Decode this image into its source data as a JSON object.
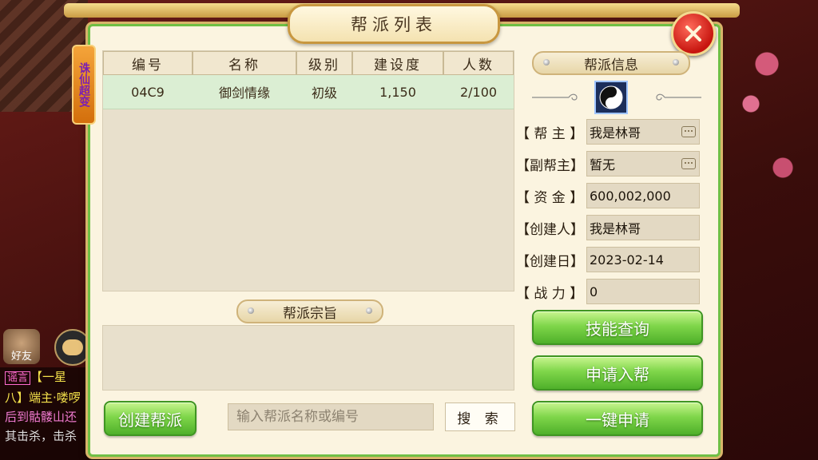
{
  "dialog": {
    "title": "帮派列表",
    "side_tab": "诛仙超变"
  },
  "table": {
    "headers": [
      "编号",
      "名称",
      "级别",
      "建设度",
      "人数"
    ],
    "rows": [
      [
        "04C9",
        "御剑情缘",
        "初级",
        "1,150",
        "2/100"
      ]
    ]
  },
  "purpose": {
    "title": "帮派宗旨",
    "text": ""
  },
  "info": {
    "title": "帮派信息",
    "emblem_icon": "yin-yang-icon",
    "fields": [
      {
        "label": "【 帮 主 】",
        "value": "我是林哥",
        "msg": true
      },
      {
        "label": "【副帮主】",
        "value": "暂无",
        "msg": true
      },
      {
        "label": "【 资 金 】",
        "value": "600,002,000",
        "msg": false
      },
      {
        "label": "【创建人】",
        "value": "我是林哥",
        "msg": false
      },
      {
        "label": "【创建日】",
        "value": "2023-02-14",
        "msg": false
      },
      {
        "label": "【 战 力 】",
        "value": "0",
        "msg": false
      }
    ]
  },
  "buttons": {
    "skill_query": "技能查询",
    "apply_join": "申请入帮",
    "one_click_apply": "一键申请",
    "create_gang": "创建帮派",
    "search": "搜 索"
  },
  "search": {
    "placeholder": "输入帮派名称或编号",
    "value": ""
  },
  "chat": {
    "friend_label": "好友",
    "lines": [
      {
        "tag": "谣言",
        "text": "【一星"
      },
      {
        "tag": "",
        "text": "八】端主·喽啰"
      },
      {
        "tag": "",
        "text": "后到骷髅山还"
      },
      {
        "tag": "",
        "text": "其击杀，击杀"
      }
    ]
  },
  "colors": {
    "panel_bg": "#fbf4e0",
    "selected_row": "#dbeed3",
    "button_green": "#7fd64a",
    "close_red": "#c7150f"
  }
}
